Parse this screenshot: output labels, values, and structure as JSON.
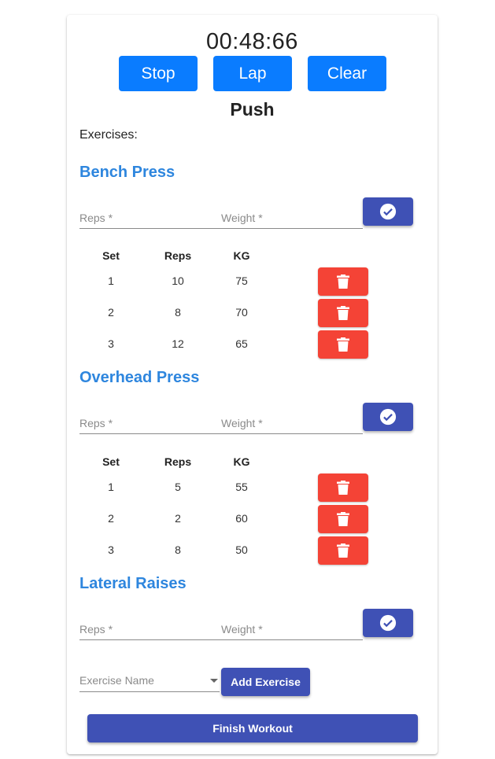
{
  "timer": "00:48:66",
  "controls": {
    "stop": "Stop",
    "lap": "Lap",
    "clear": "Clear"
  },
  "workout_title": "Push",
  "exercises_label": "Exercises:",
  "form": {
    "reps_label": "Reps *",
    "weight_label": "Weight *"
  },
  "table_headers": {
    "set": "Set",
    "reps": "Reps",
    "kg": "KG"
  },
  "exercises": [
    {
      "name": "Bench Press",
      "sets": [
        {
          "set": "1",
          "reps": "10",
          "kg": "75"
        },
        {
          "set": "2",
          "reps": "8",
          "kg": "70"
        },
        {
          "set": "3",
          "reps": "12",
          "kg": "65"
        }
      ]
    },
    {
      "name": "Overhead Press",
      "sets": [
        {
          "set": "1",
          "reps": "5",
          "kg": "55"
        },
        {
          "set": "2",
          "reps": "2",
          "kg": "60"
        },
        {
          "set": "3",
          "reps": "8",
          "kg": "50"
        }
      ]
    },
    {
      "name": "Lateral Raises",
      "sets": []
    }
  ],
  "add_exercise": {
    "placeholder": "Exercise Name",
    "button": "Add Exercise"
  },
  "finish_button": "Finish Workout",
  "icons": {
    "confirm": "check-circle-icon",
    "delete": "trash-icon",
    "dropdown": "caret-down-icon"
  },
  "colors": {
    "primary_blue": "#0a7cff",
    "indigo": "#3f51b5",
    "danger": "#f44336",
    "heading_blue": "#2e86de"
  }
}
